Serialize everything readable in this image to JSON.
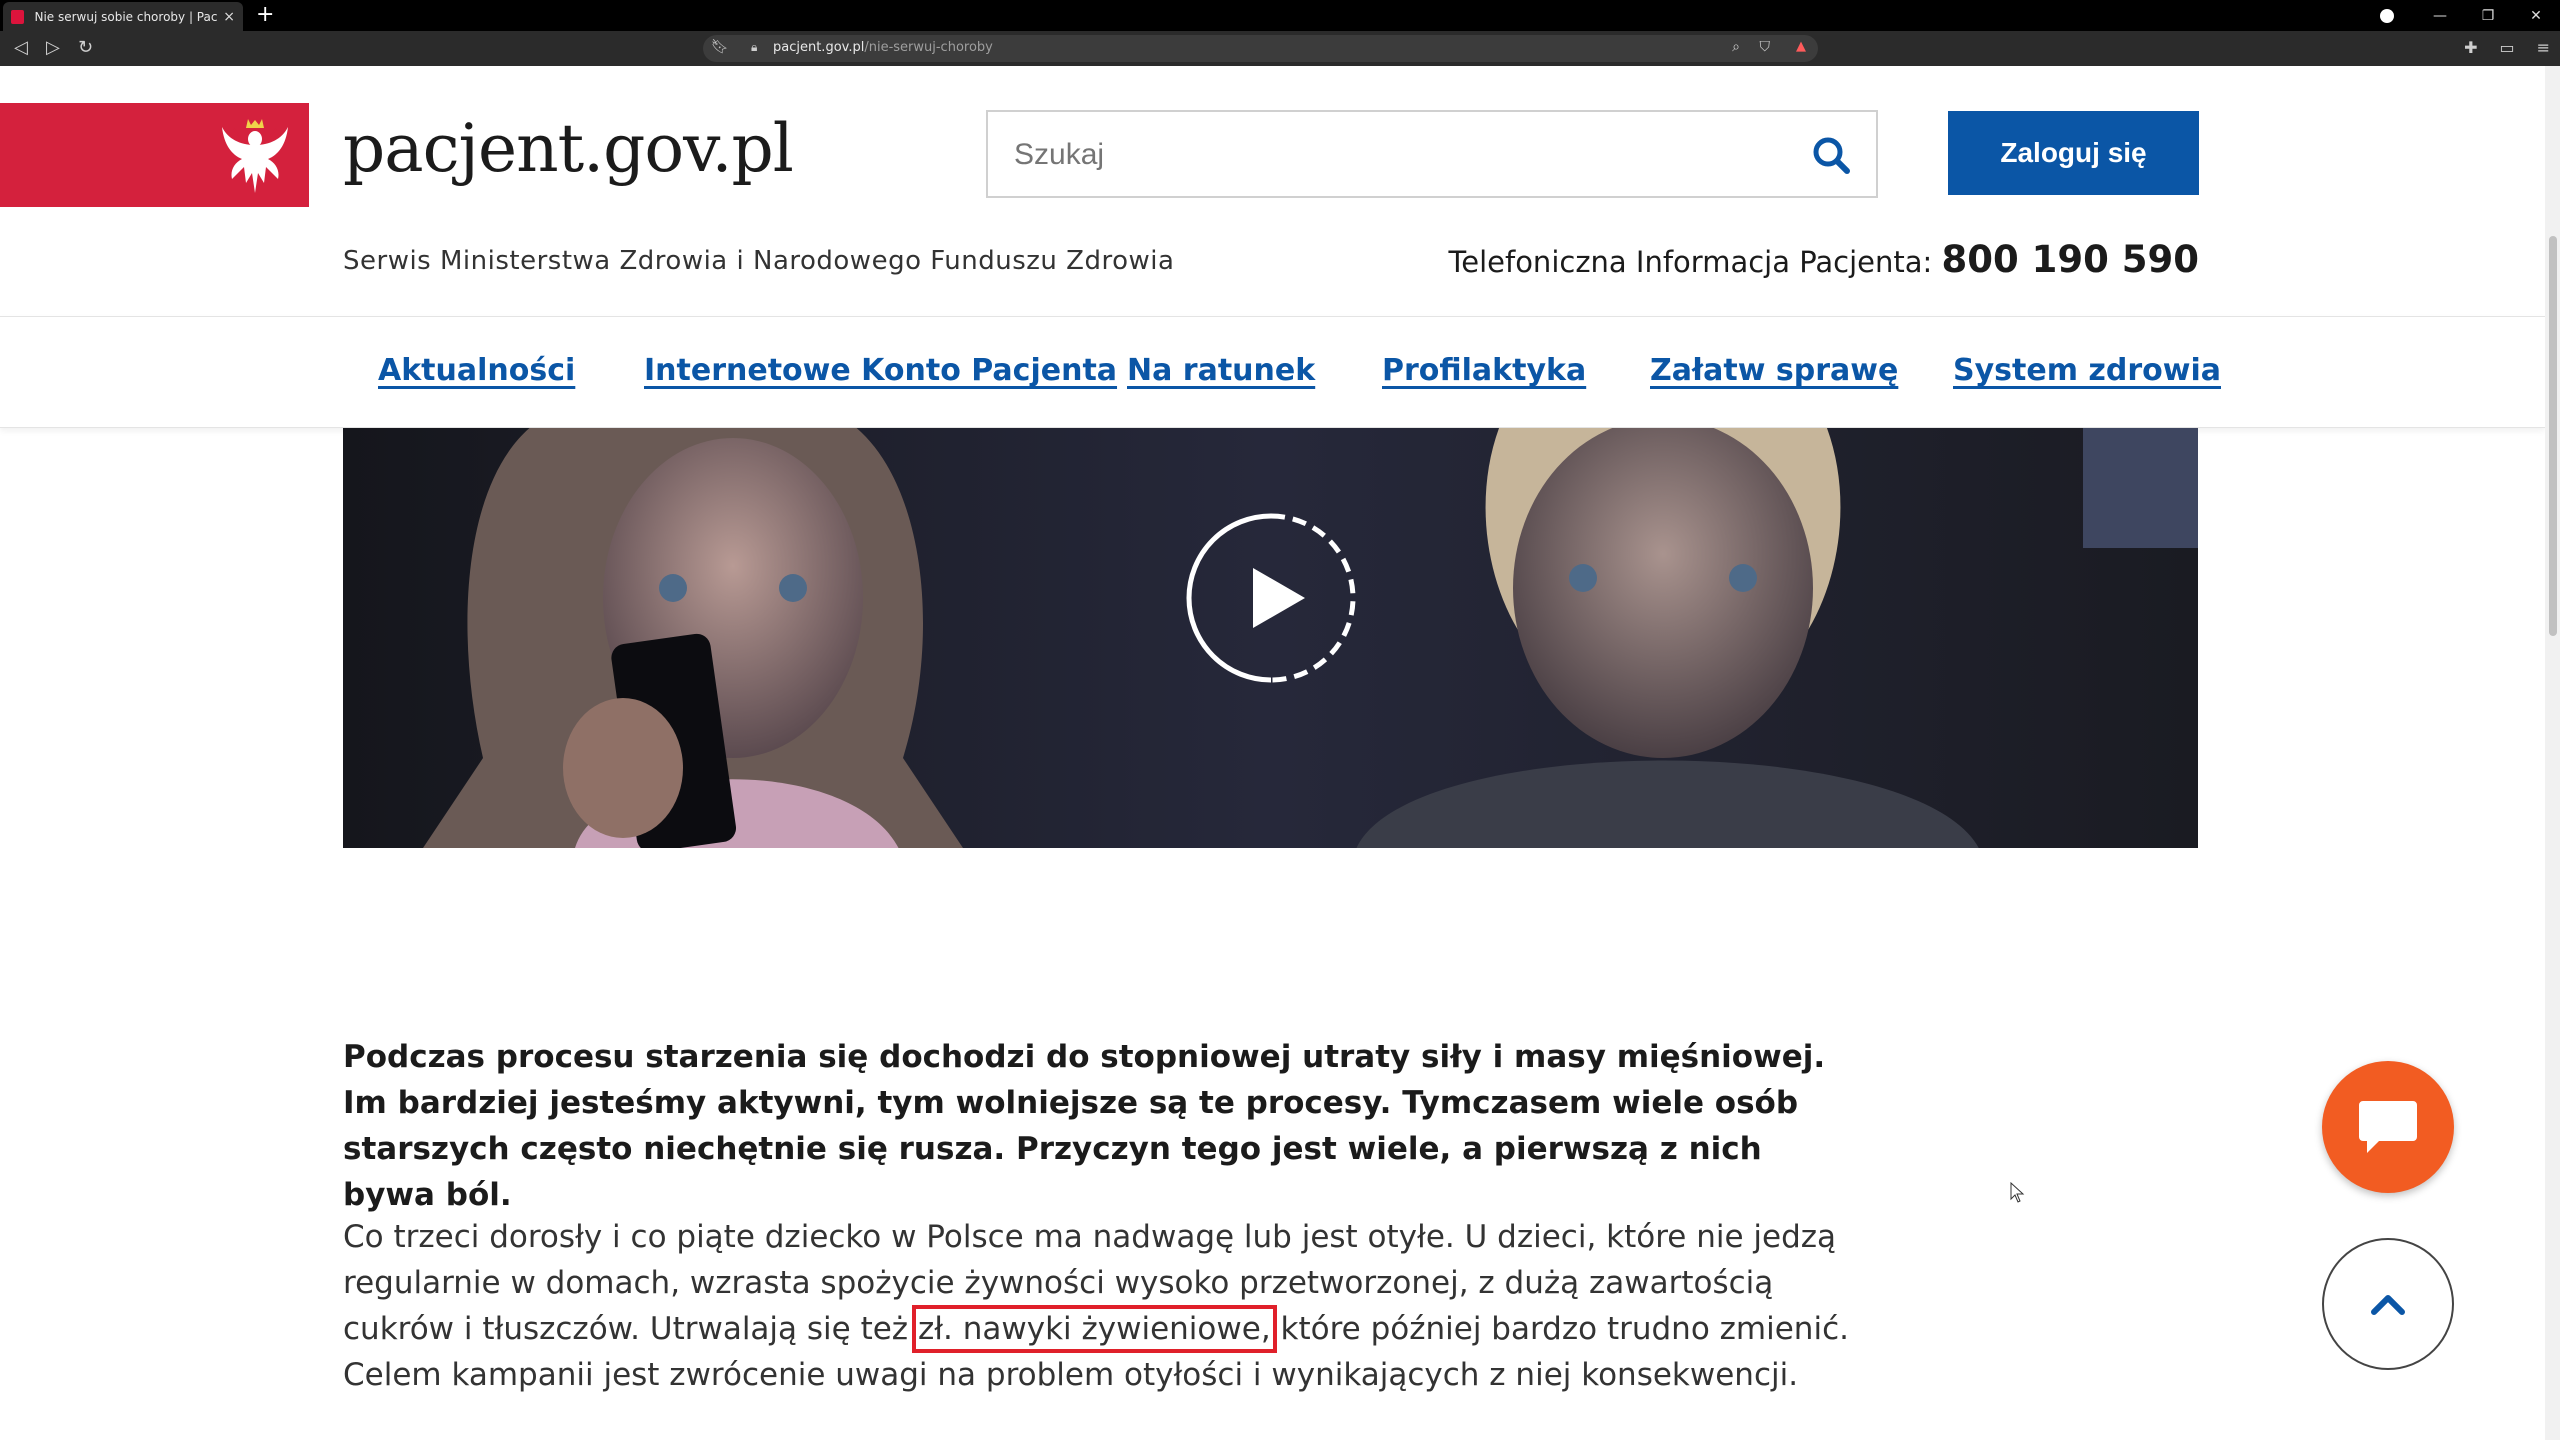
{
  "browser": {
    "tab_title": "Nie serwuj sobie choroby | Pacjent",
    "tab_close": "×",
    "new_tab": "+",
    "url_host": "pacjent.gov.pl",
    "url_path": "/nie-serwuj-choroby"
  },
  "header": {
    "site_name": "pacjent.gov.pl",
    "search_placeholder": "Szukaj",
    "login_label": "Zaloguj się",
    "subtitle": "Serwis Ministerstwa Zdrowia i Narodowego Funduszu Zdrowia",
    "hotline_label": "Telefoniczna Informacja Pacjenta:",
    "hotline_number": "800 190 590"
  },
  "nav": {
    "items": [
      {
        "label": "Aktualności"
      },
      {
        "label": "Internetowe Konto Pacjenta"
      },
      {
        "label": "Na ratunek"
      },
      {
        "label": "Profilaktyka"
      },
      {
        "label": "Załatw sprawę"
      },
      {
        "label": "System zdrowia"
      }
    ]
  },
  "article": {
    "lead": "Podczas procesu starzenia się dochodzi do stopniowej utraty siły i masy mięśniowej. Im bardziej jesteśmy aktywni, tym wolniejsze są te procesy. Tymczasem wiele osób starszych często niechętnie się rusza. Przyczyn tego jest wiele, a pierwszą z nich bywa ból.",
    "body_part1": "Co trzeci dorosły i co piąte dziecko w Polsce ma nadwagę lub jest otyłe. U dzieci, które nie jedzą regularnie w domach, wzrasta spożycie żywności wysoko przetworzonej, z dużą zawartością cukrów i tłuszczów. Utrwalają się też",
    "body_highlight": "zł. nawyki żywieniowe,",
    "body_part2": "które później bardzo trudno zmienić. Celem kampanii jest zwrócenie uwagi na problem otyłości i wynikających z niej konsekwencji."
  },
  "colors": {
    "brand_red": "#d4213d",
    "link_blue": "#0b56a6",
    "chat_orange": "#f25c22",
    "highlight_red": "#e0202a"
  },
  "icons": {
    "search": "search-icon",
    "play": "play-icon",
    "chat": "chat-icon",
    "scroll_top": "chevron-up-icon",
    "emblem": "eagle-emblem-icon"
  }
}
